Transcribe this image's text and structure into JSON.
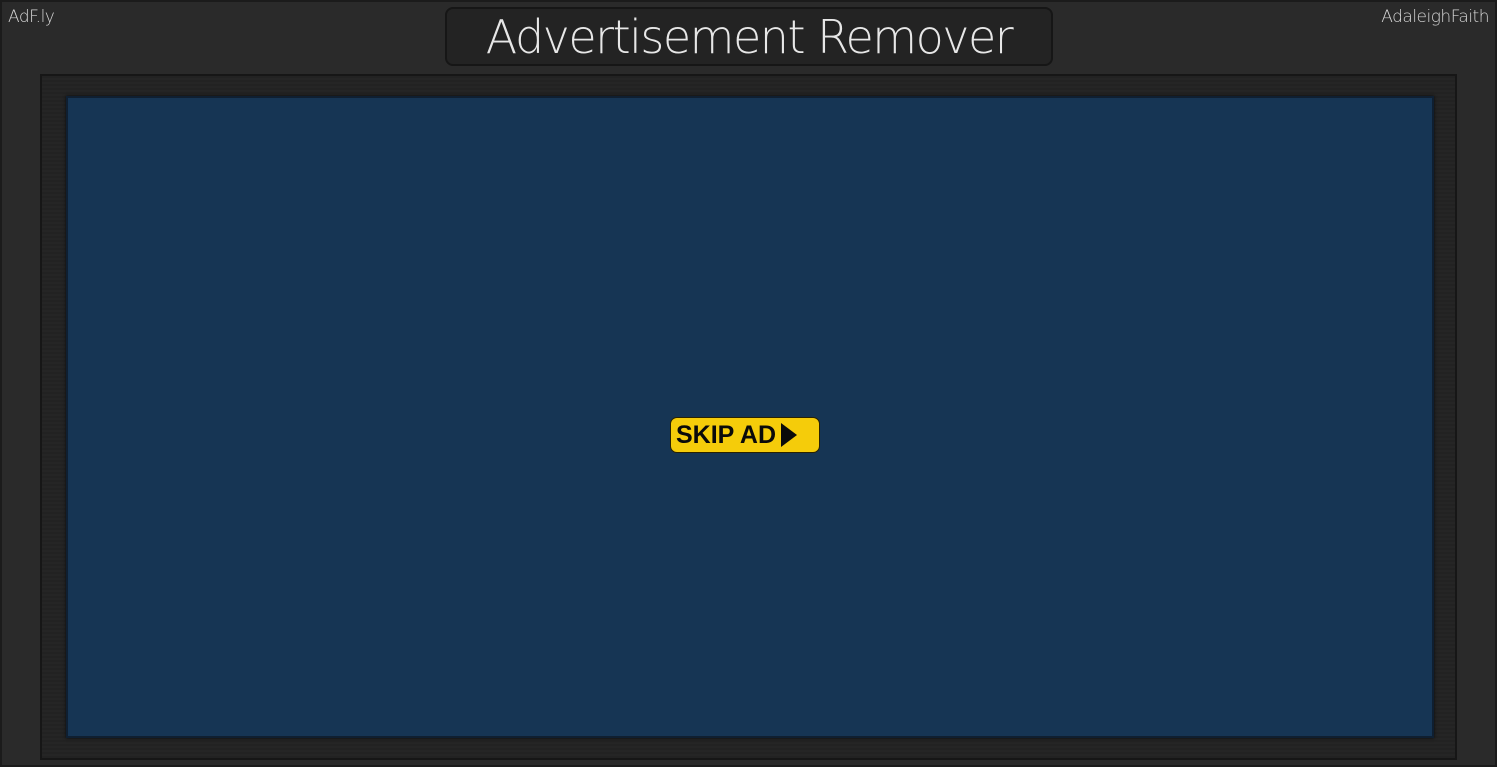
{
  "header": {
    "left_label": "AdF.ly",
    "right_label": "AdaleighFaith",
    "title": "Advertisement Remover"
  },
  "ad": {
    "skip_label": "SKIP AD",
    "skip_icon": "play-icon"
  },
  "colors": {
    "background": "#2a2a2a",
    "ad_area": "#163554",
    "skip_button": "#f5cc0a"
  }
}
